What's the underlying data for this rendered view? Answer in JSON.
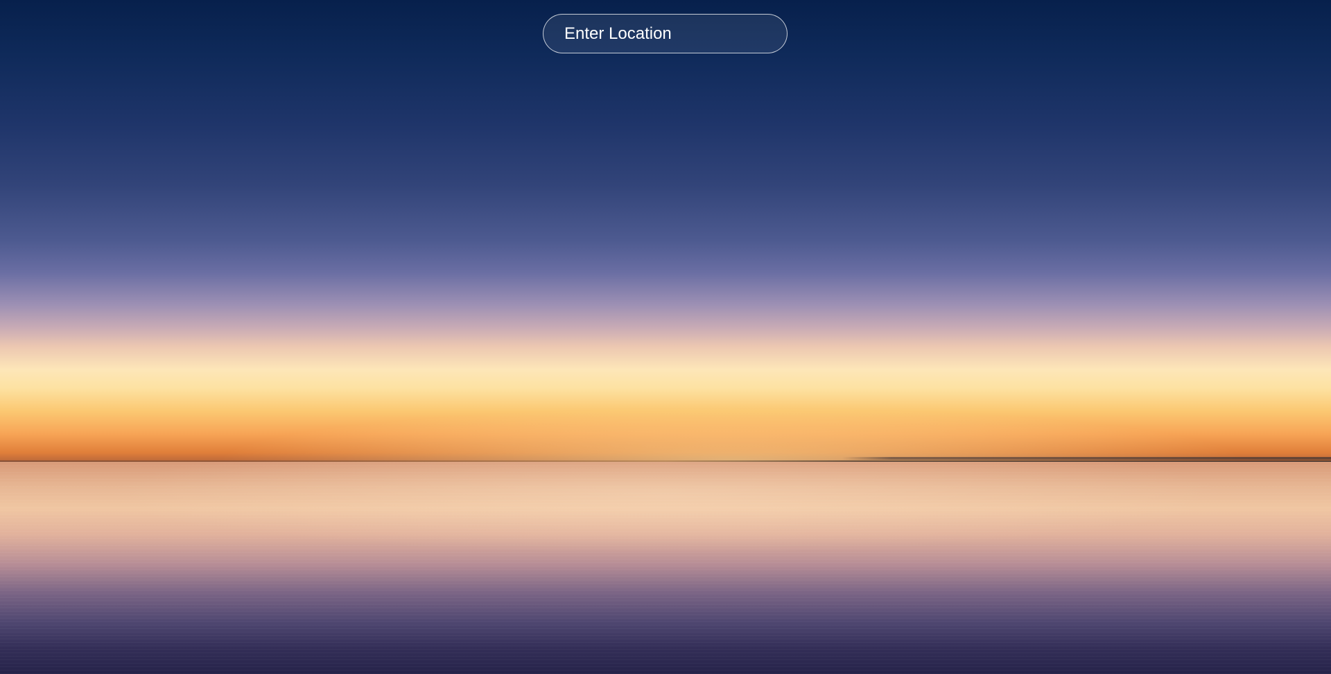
{
  "search": {
    "placeholder": "Enter Location",
    "value": ""
  },
  "background": {
    "description_colors": {
      "sky_top": "#07204c",
      "horizon_glow": "#fde6b8",
      "horizon_orange": "#f7a456",
      "water_bottom": "#26234a"
    }
  }
}
